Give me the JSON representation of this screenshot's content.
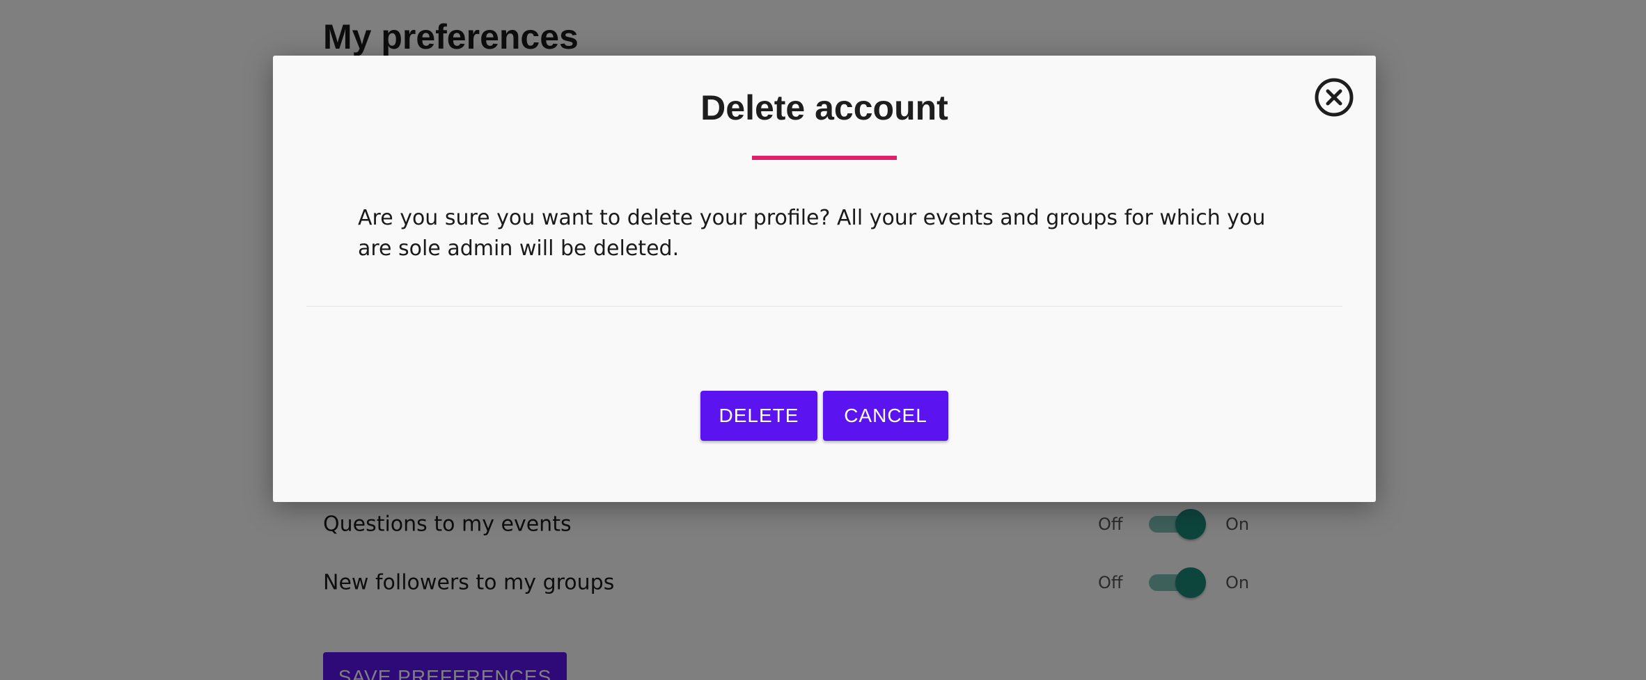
{
  "page": {
    "title": "My preferences",
    "preferences": [
      {
        "label": "Questions to my events",
        "off_label": "Off",
        "on_label": "On",
        "state": "on"
      },
      {
        "label": "New followers to my groups",
        "off_label": "Off",
        "on_label": "On",
        "state": "on"
      }
    ],
    "save_button": "SAVE PREFERENCES"
  },
  "modal": {
    "title": "Delete account",
    "body": "Are you sure you want to delete your profile? All your events and groups for which you are sole admin will be deleted.",
    "delete_button": "DELETE",
    "cancel_button": "CANCEL",
    "close_icon": "close-circle-icon"
  },
  "colors": {
    "primary_button": "#5b14f0",
    "accent_underline": "#e0206a",
    "toggle_on": "#1b8a7a"
  }
}
